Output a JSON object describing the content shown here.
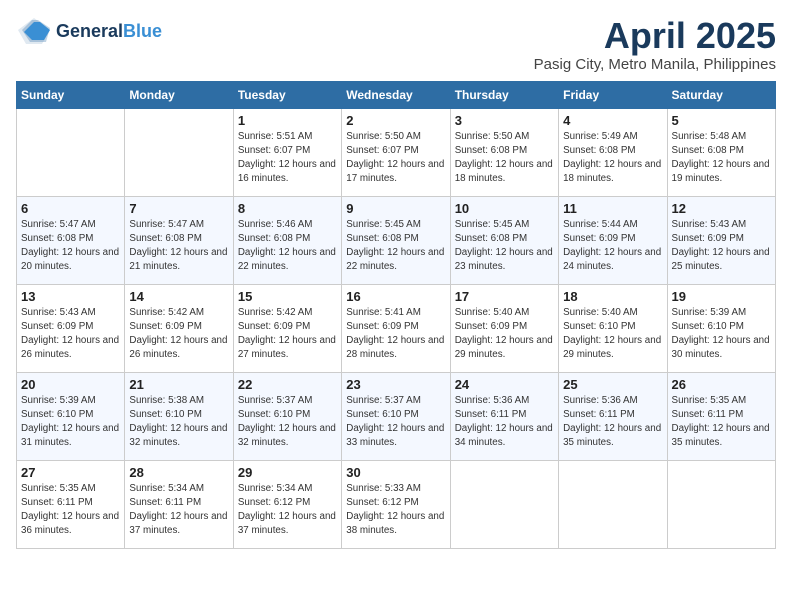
{
  "header": {
    "logo_general": "General",
    "logo_blue": "Blue",
    "month_title": "April 2025",
    "location": "Pasig City, Metro Manila, Philippines"
  },
  "weekdays": [
    "Sunday",
    "Monday",
    "Tuesday",
    "Wednesday",
    "Thursday",
    "Friday",
    "Saturday"
  ],
  "weeks": [
    [
      {
        "day": "",
        "sunrise": "",
        "sunset": "",
        "daylight": "",
        "empty": true
      },
      {
        "day": "",
        "sunrise": "",
        "sunset": "",
        "daylight": "",
        "empty": true
      },
      {
        "day": "1",
        "sunrise": "Sunrise: 5:51 AM",
        "sunset": "Sunset: 6:07 PM",
        "daylight": "Daylight: 12 hours and 16 minutes."
      },
      {
        "day": "2",
        "sunrise": "Sunrise: 5:50 AM",
        "sunset": "Sunset: 6:07 PM",
        "daylight": "Daylight: 12 hours and 17 minutes."
      },
      {
        "day": "3",
        "sunrise": "Sunrise: 5:50 AM",
        "sunset": "Sunset: 6:08 PM",
        "daylight": "Daylight: 12 hours and 18 minutes."
      },
      {
        "day": "4",
        "sunrise": "Sunrise: 5:49 AM",
        "sunset": "Sunset: 6:08 PM",
        "daylight": "Daylight: 12 hours and 18 minutes."
      },
      {
        "day": "5",
        "sunrise": "Sunrise: 5:48 AM",
        "sunset": "Sunset: 6:08 PM",
        "daylight": "Daylight: 12 hours and 19 minutes."
      }
    ],
    [
      {
        "day": "6",
        "sunrise": "Sunrise: 5:47 AM",
        "sunset": "Sunset: 6:08 PM",
        "daylight": "Daylight: 12 hours and 20 minutes."
      },
      {
        "day": "7",
        "sunrise": "Sunrise: 5:47 AM",
        "sunset": "Sunset: 6:08 PM",
        "daylight": "Daylight: 12 hours and 21 minutes."
      },
      {
        "day": "8",
        "sunrise": "Sunrise: 5:46 AM",
        "sunset": "Sunset: 6:08 PM",
        "daylight": "Daylight: 12 hours and 22 minutes."
      },
      {
        "day": "9",
        "sunrise": "Sunrise: 5:45 AM",
        "sunset": "Sunset: 6:08 PM",
        "daylight": "Daylight: 12 hours and 22 minutes."
      },
      {
        "day": "10",
        "sunrise": "Sunrise: 5:45 AM",
        "sunset": "Sunset: 6:08 PM",
        "daylight": "Daylight: 12 hours and 23 minutes."
      },
      {
        "day": "11",
        "sunrise": "Sunrise: 5:44 AM",
        "sunset": "Sunset: 6:09 PM",
        "daylight": "Daylight: 12 hours and 24 minutes."
      },
      {
        "day": "12",
        "sunrise": "Sunrise: 5:43 AM",
        "sunset": "Sunset: 6:09 PM",
        "daylight": "Daylight: 12 hours and 25 minutes."
      }
    ],
    [
      {
        "day": "13",
        "sunrise": "Sunrise: 5:43 AM",
        "sunset": "Sunset: 6:09 PM",
        "daylight": "Daylight: 12 hours and 26 minutes."
      },
      {
        "day": "14",
        "sunrise": "Sunrise: 5:42 AM",
        "sunset": "Sunset: 6:09 PM",
        "daylight": "Daylight: 12 hours and 26 minutes."
      },
      {
        "day": "15",
        "sunrise": "Sunrise: 5:42 AM",
        "sunset": "Sunset: 6:09 PM",
        "daylight": "Daylight: 12 hours and 27 minutes."
      },
      {
        "day": "16",
        "sunrise": "Sunrise: 5:41 AM",
        "sunset": "Sunset: 6:09 PM",
        "daylight": "Daylight: 12 hours and 28 minutes."
      },
      {
        "day": "17",
        "sunrise": "Sunrise: 5:40 AM",
        "sunset": "Sunset: 6:09 PM",
        "daylight": "Daylight: 12 hours and 29 minutes."
      },
      {
        "day": "18",
        "sunrise": "Sunrise: 5:40 AM",
        "sunset": "Sunset: 6:10 PM",
        "daylight": "Daylight: 12 hours and 29 minutes."
      },
      {
        "day": "19",
        "sunrise": "Sunrise: 5:39 AM",
        "sunset": "Sunset: 6:10 PM",
        "daylight": "Daylight: 12 hours and 30 minutes."
      }
    ],
    [
      {
        "day": "20",
        "sunrise": "Sunrise: 5:39 AM",
        "sunset": "Sunset: 6:10 PM",
        "daylight": "Daylight: 12 hours and 31 minutes."
      },
      {
        "day": "21",
        "sunrise": "Sunrise: 5:38 AM",
        "sunset": "Sunset: 6:10 PM",
        "daylight": "Daylight: 12 hours and 32 minutes."
      },
      {
        "day": "22",
        "sunrise": "Sunrise: 5:37 AM",
        "sunset": "Sunset: 6:10 PM",
        "daylight": "Daylight: 12 hours and 32 minutes."
      },
      {
        "day": "23",
        "sunrise": "Sunrise: 5:37 AM",
        "sunset": "Sunset: 6:10 PM",
        "daylight": "Daylight: 12 hours and 33 minutes."
      },
      {
        "day": "24",
        "sunrise": "Sunrise: 5:36 AM",
        "sunset": "Sunset: 6:11 PM",
        "daylight": "Daylight: 12 hours and 34 minutes."
      },
      {
        "day": "25",
        "sunrise": "Sunrise: 5:36 AM",
        "sunset": "Sunset: 6:11 PM",
        "daylight": "Daylight: 12 hours and 35 minutes."
      },
      {
        "day": "26",
        "sunrise": "Sunrise: 5:35 AM",
        "sunset": "Sunset: 6:11 PM",
        "daylight": "Daylight: 12 hours and 35 minutes."
      }
    ],
    [
      {
        "day": "27",
        "sunrise": "Sunrise: 5:35 AM",
        "sunset": "Sunset: 6:11 PM",
        "daylight": "Daylight: 12 hours and 36 minutes."
      },
      {
        "day": "28",
        "sunrise": "Sunrise: 5:34 AM",
        "sunset": "Sunset: 6:11 PM",
        "daylight": "Daylight: 12 hours and 37 minutes."
      },
      {
        "day": "29",
        "sunrise": "Sunrise: 5:34 AM",
        "sunset": "Sunset: 6:12 PM",
        "daylight": "Daylight: 12 hours and 37 minutes."
      },
      {
        "day": "30",
        "sunrise": "Sunrise: 5:33 AM",
        "sunset": "Sunset: 6:12 PM",
        "daylight": "Daylight: 12 hours and 38 minutes."
      },
      {
        "day": "",
        "sunrise": "",
        "sunset": "",
        "daylight": "",
        "empty": true
      },
      {
        "day": "",
        "sunrise": "",
        "sunset": "",
        "daylight": "",
        "empty": true
      },
      {
        "day": "",
        "sunrise": "",
        "sunset": "",
        "daylight": "",
        "empty": true
      }
    ]
  ]
}
